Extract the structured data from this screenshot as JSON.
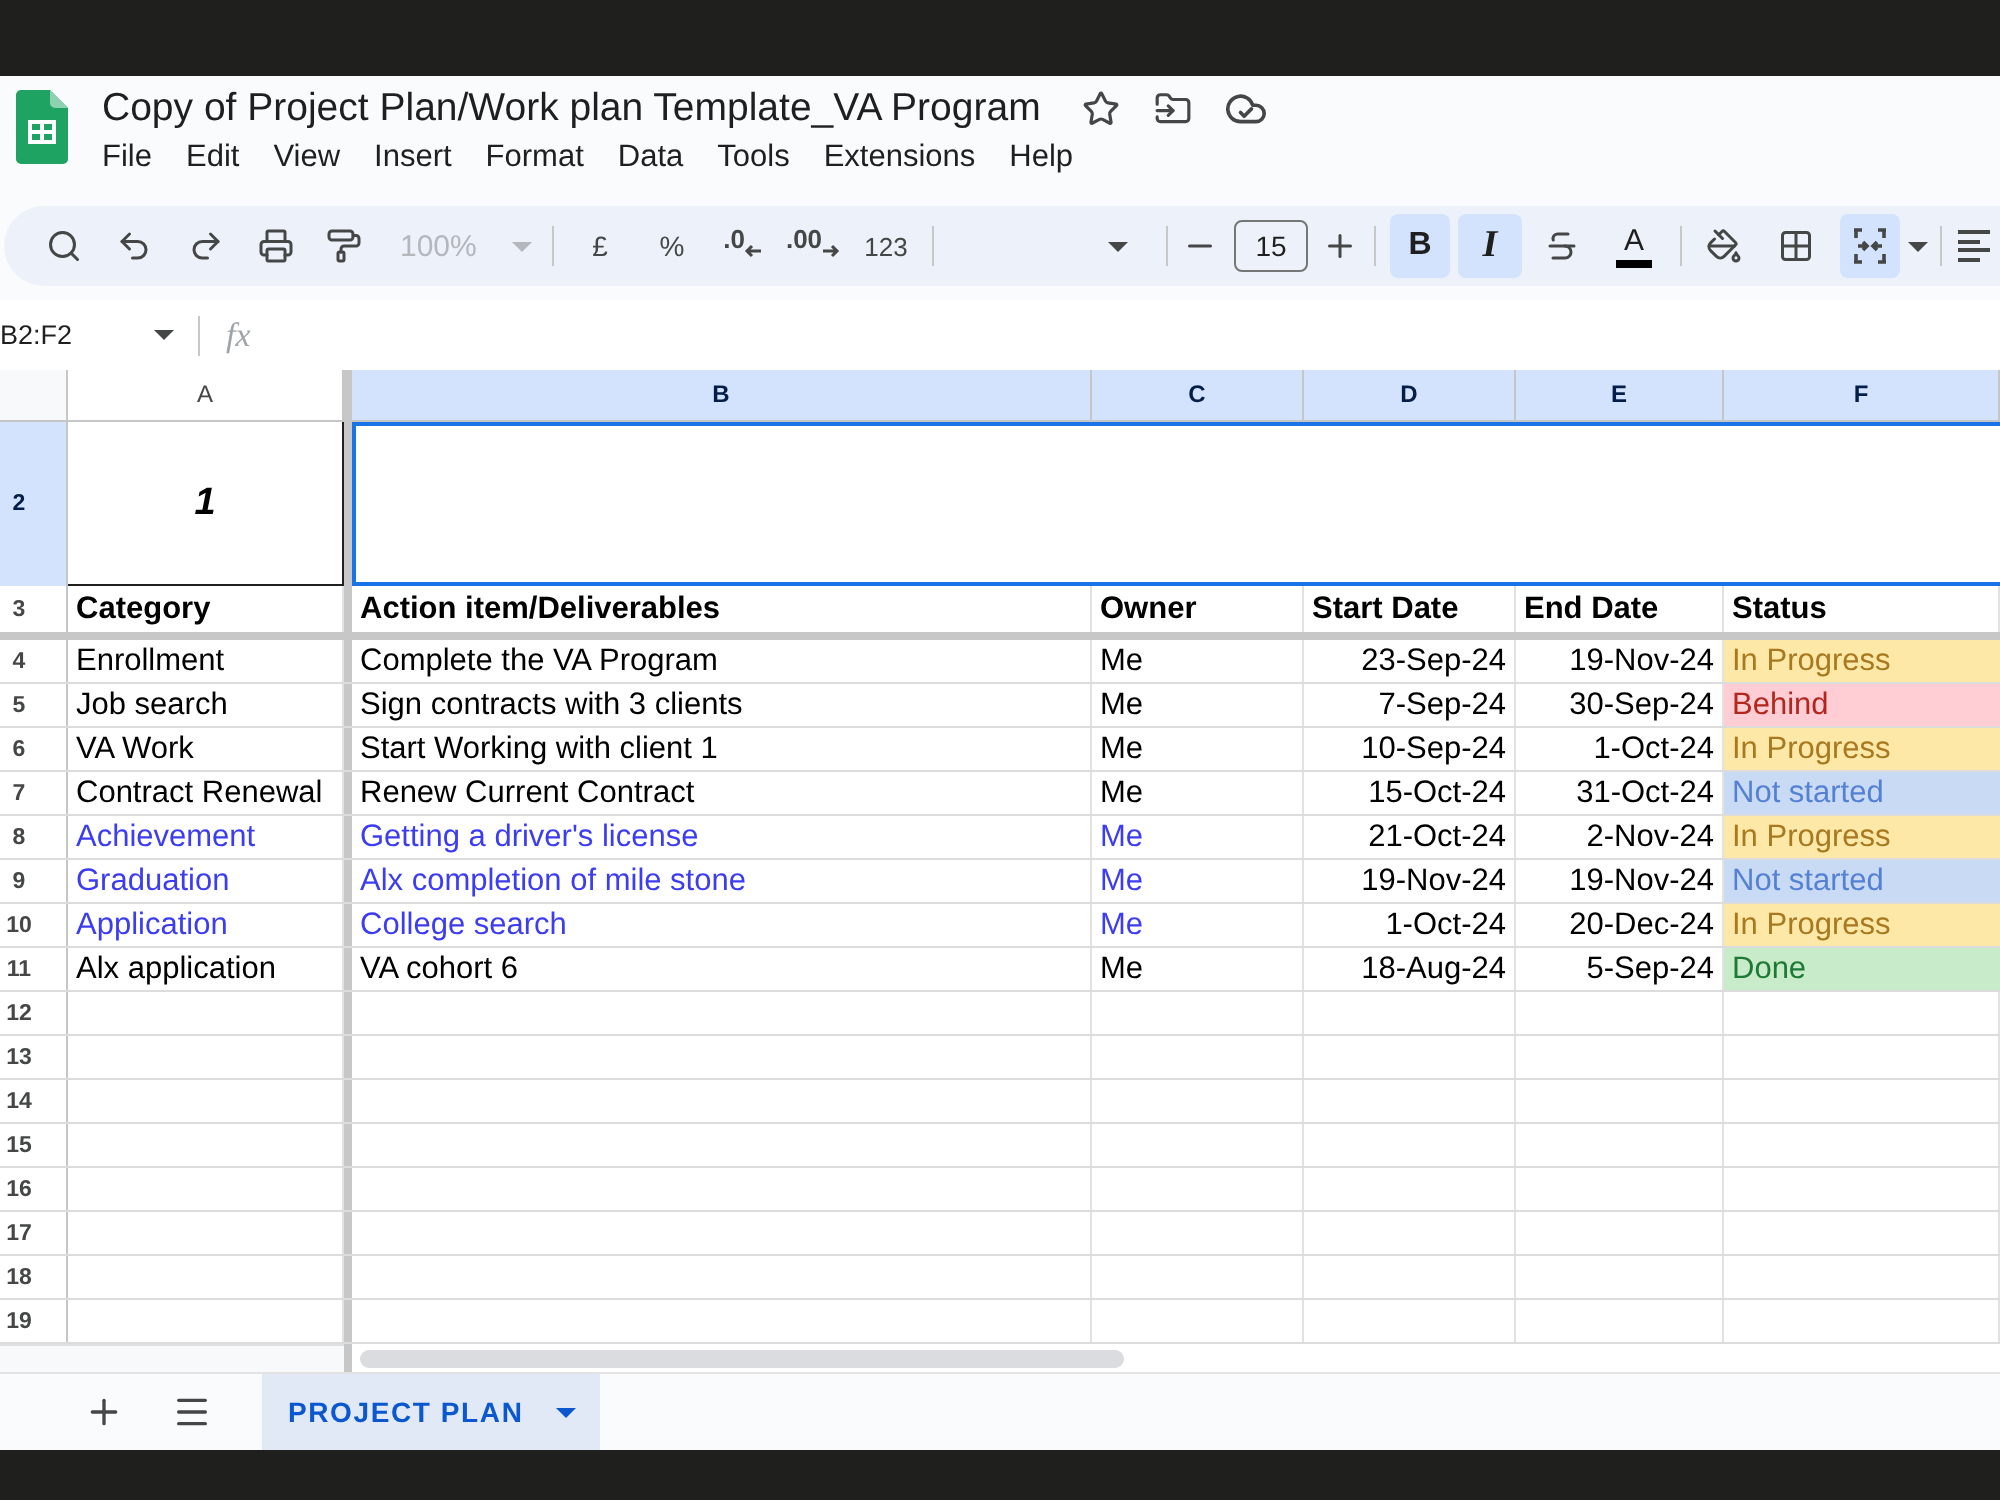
{
  "document": {
    "title": "Copy of Project Plan/Work plan Template_VA Program"
  },
  "menu": [
    "File",
    "Edit",
    "View",
    "Insert",
    "Format",
    "Data",
    "Tools",
    "Extensions",
    "Help"
  ],
  "toolbar": {
    "zoom": {
      "label": "100%",
      "disabled": true
    },
    "currency": "£",
    "percent": "%",
    "decrease_decimals": ".0",
    "increase_decimals": ".00",
    "number_format": "123",
    "font_size": "15",
    "bold": {
      "label": "B",
      "on": true
    },
    "italic": {
      "label": "I",
      "on": true
    },
    "text_color": {
      "label": "A",
      "color": "#000000"
    },
    "merge": {
      "on": true
    }
  },
  "formula_bar": {
    "name_box": "B2:F2",
    "fx": "fx"
  },
  "grid": {
    "columns": [
      {
        "label": "A",
        "selected": false
      },
      {
        "label": "B",
        "selected": true
      },
      {
        "label": "C",
        "selected": true
      },
      {
        "label": "D",
        "selected": true
      },
      {
        "label": "E",
        "selected": true
      },
      {
        "label": "F",
        "selected": true
      }
    ],
    "title_row": {
      "number": "2",
      "selected": true,
      "value": "1"
    },
    "header_row": {
      "number": "3",
      "selected": false,
      "cells": [
        "Category",
        "Action item/Deliverables",
        "Owner",
        "Start Date",
        "End Date",
        "Status"
      ]
    },
    "rows": [
      {
        "number": "4",
        "selected": false,
        "color": "#000000",
        "category": "Enrollment",
        "action": "Complete the VA Program",
        "owner": "Me",
        "start": "23-Sep-24",
        "end": "19-Nov-24",
        "status": {
          "label": "In Progress",
          "kind": "in_progress",
          "color": "#fde8a8"
        }
      },
      {
        "number": "5",
        "selected": false,
        "color": "#000000",
        "category": "Job search",
        "action": "Sign contracts with 3 clients",
        "owner": "Me",
        "start": "7-Sep-24",
        "end": "30-Sep-24",
        "status": {
          "label": "Behind",
          "kind": "behind",
          "color": "#ffcdd3"
        }
      },
      {
        "number": "6",
        "selected": false,
        "color": "#000000",
        "category": "VA Work",
        "action": "Start Working with client 1",
        "owner": "Me",
        "start": "10-Sep-24",
        "end": "1-Oct-24",
        "status": {
          "label": "In Progress",
          "kind": "in_progress",
          "color": "#fde8a8"
        }
      },
      {
        "number": "7",
        "selected": false,
        "color": "#000000",
        "category": "Contract Renewal",
        "action": "Renew Current Contract",
        "owner": "Me",
        "start": "15-Oct-24",
        "end": "31-Oct-24",
        "status": {
          "label": "Not started",
          "kind": "not_started",
          "color": "#c9daf5"
        }
      },
      {
        "number": "8",
        "selected": false,
        "color": "#3c3cf2",
        "category": "Achievement",
        "action": "Getting a driver's license",
        "owner": "Me",
        "start": "21-Oct-24",
        "end": "2-Nov-24",
        "status": {
          "label": "In Progress",
          "kind": "in_progress",
          "color": "#fde8a8"
        }
      },
      {
        "number": "9",
        "selected": false,
        "color": "#3c3cf2",
        "category": "Graduation",
        "action": "Alx completion of mile stone",
        "owner": "Me",
        "start": "19-Nov-24",
        "end": "19-Nov-24",
        "status": {
          "label": "Not started",
          "kind": "not_started",
          "color": "#c9daf5"
        }
      },
      {
        "number": "10",
        "selected": false,
        "color": "#3c3cf2",
        "category": "Application",
        "action": "College search",
        "owner": "Me",
        "start": "1-Oct-24",
        "end": "20-Dec-24",
        "status": {
          "label": "In Progress",
          "kind": "in_progress",
          "color": "#fde8a8"
        }
      },
      {
        "number": "11",
        "selected": false,
        "color": "#000000",
        "category": "Alx application",
        "action": "VA cohort 6",
        "owner": "Me",
        "start": "18-Aug-24",
        "end": "5-Sep-24",
        "status": {
          "label": "Done",
          "kind": "done",
          "color": "#c8ebc9"
        }
      }
    ],
    "empty_rows": [
      {
        "number": "12",
        "selected": false
      },
      {
        "number": "13",
        "selected": false
      },
      {
        "number": "14",
        "selected": false
      },
      {
        "number": "15",
        "selected": false
      },
      {
        "number": "16",
        "selected": false
      },
      {
        "number": "17",
        "selected": false
      },
      {
        "number": "18",
        "selected": false
      },
      {
        "number": "19",
        "selected": false
      }
    ]
  },
  "sheet_tabs": [
    {
      "label": "PROJECT PLAN",
      "selected": true
    }
  ]
}
